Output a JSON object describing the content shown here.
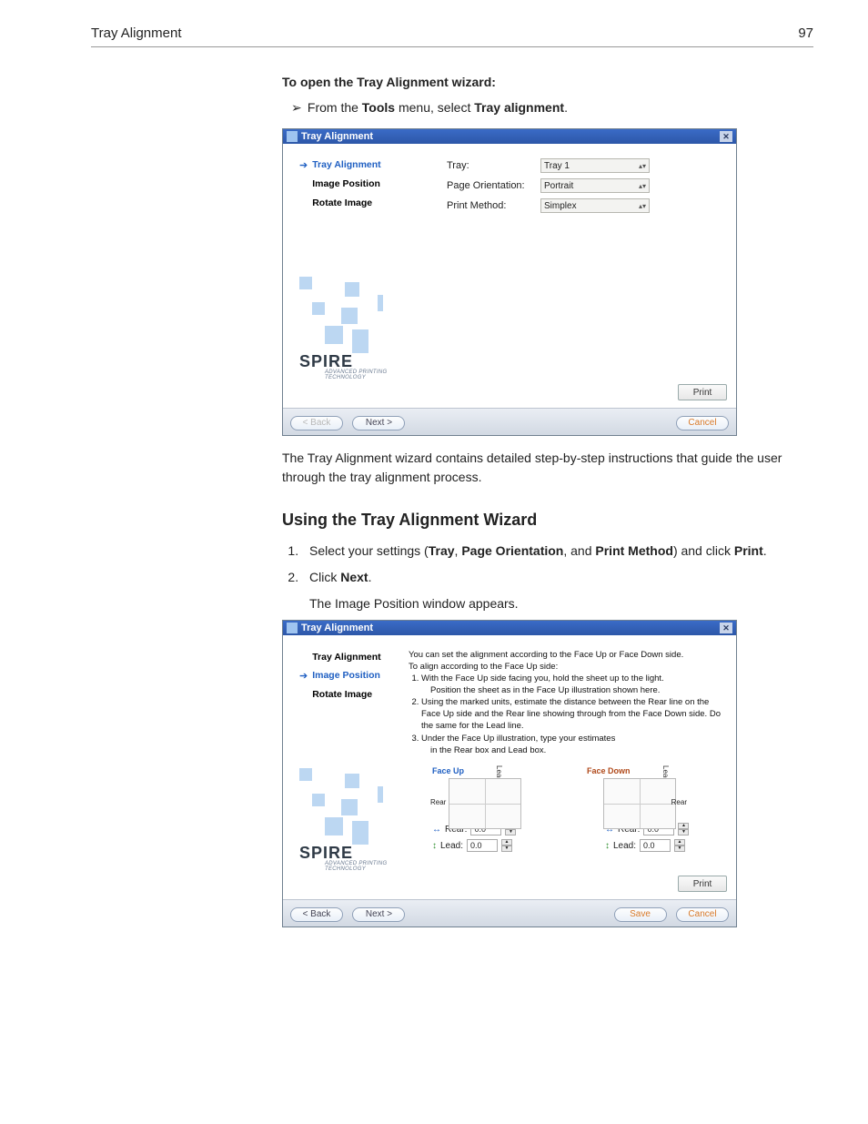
{
  "runhead": {
    "title": "Tray Alignment",
    "page_no": "97"
  },
  "intro": {
    "title": "To open the Tray Alignment wizard:",
    "line_prefix": "From the ",
    "tools": "Tools",
    "line_mid": " menu, select ",
    "item": "Tray alignment",
    "line_end": "."
  },
  "wiz_title": "Tray Alignment",
  "steps_sidebar": {
    "s1": "Tray Alignment",
    "s2": "Image Position",
    "s3": "Rotate Image"
  },
  "brand": {
    "name": "SPIRE",
    "tag": "ADVANCED PRINTING TECHNOLOGY"
  },
  "win1": {
    "labels": {
      "tray": "Tray:",
      "orient": "Page Orientation:",
      "method": "Print Method:"
    },
    "values": {
      "tray": "Tray 1",
      "orient": "Portrait",
      "method": "Simplex"
    }
  },
  "buttons": {
    "print": "Print",
    "back": "< Back",
    "next": "Next >",
    "cancel": "Cancel",
    "save": "Save"
  },
  "para1": "The Tray Alignment wizard contains detailed step-by-step instructions that guide the user through the tray alignment process.",
  "section2": {
    "heading": "Using the Tray Alignment Wizard",
    "li1_pre": "Select your settings (",
    "li1_b1": "Tray",
    "li1_c1": ", ",
    "li1_b2": "Page Orientation",
    "li1_c2": ", and ",
    "li1_b3": "Print Method",
    "li1_c3": ") and click ",
    "li1_b4": "Print",
    "li1_end": ".",
    "li2_pre": "Click ",
    "li2_b": "Next",
    "li2_end": ".",
    "after": "The Image Position window appears."
  },
  "win2": {
    "instr_lead": "You can set the alignment according to the Face Up or Face Down side.",
    "instr_lead2": "To align according to the Face Up side:",
    "i1a": "With the Face Up side facing you, hold the sheet up to the light.",
    "i1b": "Position the sheet as in the Face Up illustration shown here.",
    "i2a": "Using the marked units, estimate the distance between the Rear line on the Face Up side and the Rear line showing through from the Face Down side. Do the same for the Lead line.",
    "i3a": "Under the Face Up illustration, type your estimates",
    "i3b": "in the Rear box and Lead box.",
    "faceup": "Face Up",
    "facedown": "Face Down",
    "lead": "Lead",
    "rear": "Rear",
    "rear_lbl": "Rear:",
    "lead_lbl": "Lead:",
    "zero": "0.0"
  }
}
